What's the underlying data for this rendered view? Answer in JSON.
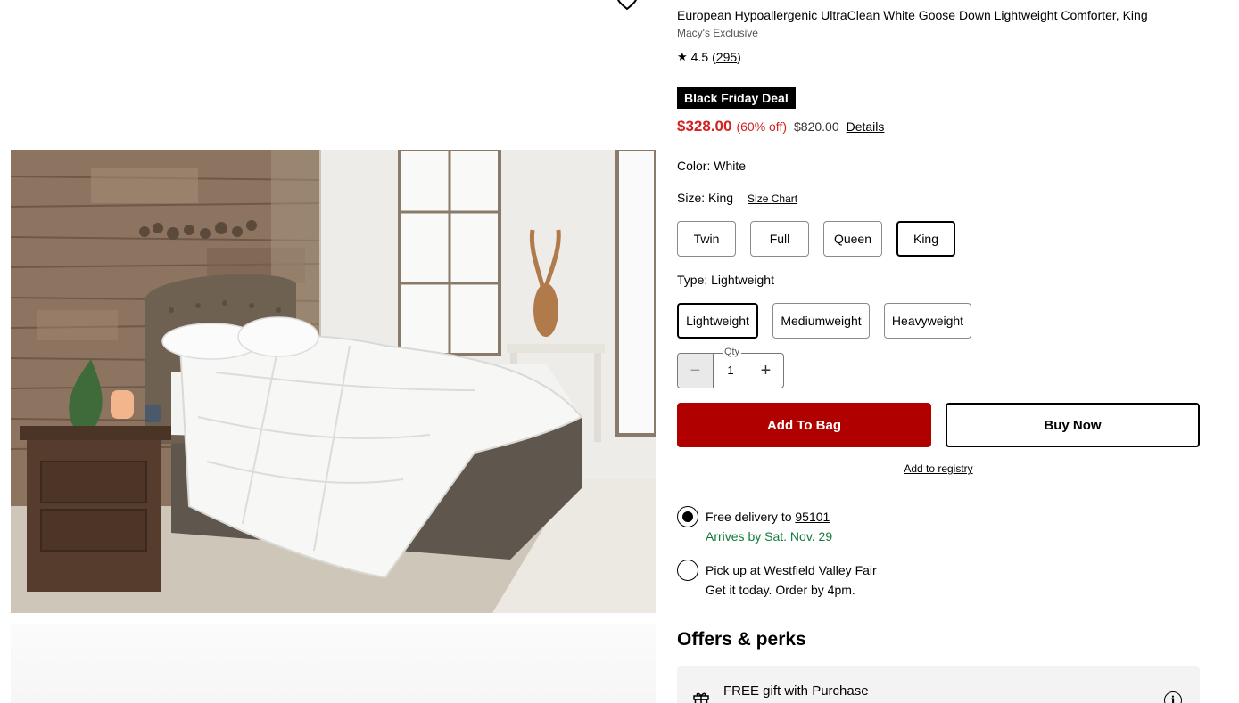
{
  "product": {
    "title": "European Hypoallergenic UltraClean White Goose Down Lightweight Comforter, King",
    "brand": "Macy's Exclusive",
    "rating_value": "4.5",
    "review_count": "295",
    "rating_icon": "star-icon",
    "image_alt": "Bedroom with tufted bed and white down comforter"
  },
  "deal": {
    "badge": "Black Friday Deal",
    "sale_price": "$328.00",
    "discount": "(60% off)",
    "original_price": "$820.00",
    "details_link": "Details"
  },
  "options": {
    "color_label": "Color: White",
    "size_label": "Size: King",
    "size_chart_link": "Size Chart",
    "sizes": [
      "Twin",
      "Full",
      "Queen",
      "King"
    ],
    "selected_size": "King",
    "type_label": "Type: Lightweight",
    "types": [
      "Lightweight",
      "Mediumweight",
      "Heavyweight"
    ],
    "selected_type": "Lightweight"
  },
  "quantity": {
    "label": "Qty",
    "value": "1",
    "minus": "−",
    "plus": "+"
  },
  "actions": {
    "add_to_bag": "Add To Bag",
    "buy_now": "Buy Now",
    "add_to_registry": "Add to registry"
  },
  "fulfillment": {
    "delivery": {
      "label": "Free delivery",
      "connector": "to",
      "zip": "95101",
      "eta": "Arrives by Sat. Nov. 29",
      "selected": true
    },
    "pickup": {
      "label": "Pick up at",
      "store": "Westfield Valley Fair",
      "eta": "Get it today. Order by 4pm.",
      "selected": false
    }
  },
  "offers": {
    "title": "Offers & perks",
    "first_offer": "FREE gift with Purchase",
    "info_icon_char": "i"
  },
  "colors": {
    "sale_red": "#d12121",
    "button_red": "#b00000",
    "delivery_green": "#137a3c"
  }
}
